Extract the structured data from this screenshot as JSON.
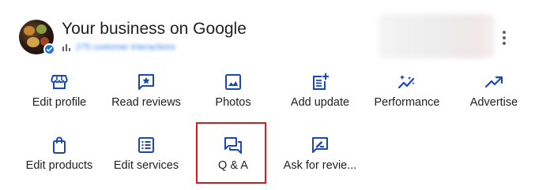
{
  "header": {
    "title": "Your business on Google",
    "subtitle_link": "275 customer interactions",
    "more_options_icon": "more-vert-icon",
    "verified_icon": "verified-check-icon"
  },
  "actions": [
    {
      "label": "Edit profile",
      "icon": "storefront-icon"
    },
    {
      "label": "Read reviews",
      "icon": "star-message-icon"
    },
    {
      "label": "Photos",
      "icon": "image-icon"
    },
    {
      "label": "Add update",
      "icon": "post-add-icon"
    },
    {
      "label": "Performance",
      "icon": "sparkle-trend-icon"
    },
    {
      "label": "Advertise",
      "icon": "trending-up-icon"
    },
    {
      "label": "Edit products",
      "icon": "shopping-bag-icon"
    },
    {
      "label": "Edit services",
      "icon": "list-icon"
    },
    {
      "label": "Q & A",
      "icon": "forum-icon"
    },
    {
      "label": "Ask for revie...",
      "icon": "rate-review-icon"
    }
  ],
  "colors": {
    "accent_icon": "#1a47b8",
    "text": "#202124",
    "link": "#1a73e8",
    "highlight_border": "#d81919"
  }
}
